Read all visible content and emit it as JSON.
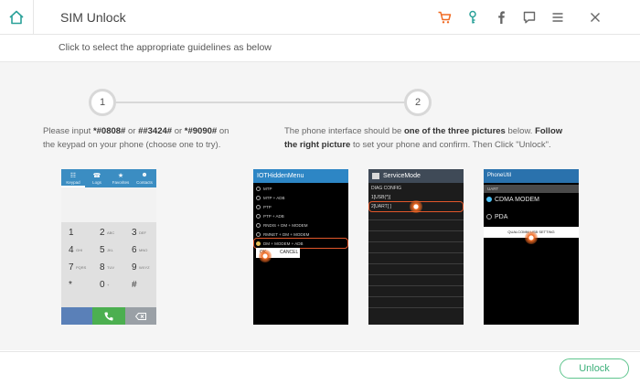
{
  "window": {
    "title": "SIM Unlock",
    "colors": {
      "accent": "#3db07a",
      "orange": "#f06a22",
      "teal": "#2ba199"
    }
  },
  "toolbar_icons": [
    "home-icon",
    "cart-icon",
    "key-icon",
    "facebook-icon",
    "feedback-icon",
    "menu-icon",
    "close-icon"
  ],
  "subheader": {
    "text": "Click to select the appropriate guidelines as below"
  },
  "steps": [
    {
      "number": "1",
      "line1_pre": "Please input ",
      "code1": "*#0808#",
      "or1": " or ",
      "code2": "##3424#",
      "or2": " or ",
      "code3": "*#9090#",
      "line1_post": " on",
      "line2": "the keypad on your phone (choose one to try)."
    },
    {
      "number": "2",
      "line1_pre": "The phone interface should be ",
      "bold1": "one of the three pictures",
      "line1_mid": " below. ",
      "bold2": "Follow",
      "line2_bold": "the right picture",
      "line2_post": " to set your phone and confirm. Then Click \"Unlock\"."
    }
  ],
  "keypad_phone": {
    "tabs": [
      "Keypad",
      "Logs",
      "Favorites",
      "Contacts"
    ],
    "keys": [
      {
        "digit": "1",
        "letters": ""
      },
      {
        "digit": "2",
        "letters": "ABC"
      },
      {
        "digit": "3",
        "letters": "DEF"
      },
      {
        "digit": "4",
        "letters": "GHI"
      },
      {
        "digit": "5",
        "letters": "JKL"
      },
      {
        "digit": "6",
        "letters": "MNO"
      },
      {
        "digit": "7",
        "letters": "PQRS"
      },
      {
        "digit": "8",
        "letters": "TUV"
      },
      {
        "digit": "9",
        "letters": "WXYZ"
      },
      {
        "digit": "*",
        "letters": ""
      },
      {
        "digit": "0",
        "letters": "+"
      },
      {
        "digit": "#",
        "letters": ""
      }
    ]
  },
  "hidden_menu_phone": {
    "title": "IOTHiddenMenu",
    "options": [
      "MTP",
      "MTP + ADB",
      "PTP",
      "PTP + ADB",
      "RNDIS + DM + MODEM",
      "RMNET + DM + MODEM",
      "DM + MODEM + ADB"
    ],
    "selected_index": 6,
    "ok": "OK",
    "cancel": "CANCEL"
  },
  "service_mode_phone": {
    "title": "ServiceMode",
    "lines": [
      "DIAG CONFIG",
      "1[USB(*)]",
      "2[UART[ ]"
    ]
  },
  "phone_util_phone": {
    "title": "PhoneUtil",
    "section": "UART",
    "options": [
      "CDMA MODEM",
      "PDA"
    ],
    "selected_index": 0,
    "button": "QUALCOMM USB SETTING"
  },
  "footer": {
    "unlock_label": "Unlock"
  }
}
